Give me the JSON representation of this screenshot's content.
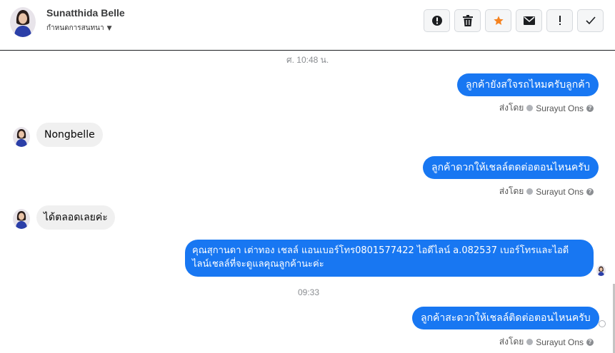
{
  "header": {
    "contact_name": "Sunatthida Belle",
    "assign_label": "กำหนดการสนทนา",
    "toolbar": [
      {
        "name": "spam-button",
        "icon": "alert-circle-icon"
      },
      {
        "name": "delete-button",
        "icon": "trash-icon"
      },
      {
        "name": "star-button",
        "icon": "star-icon"
      },
      {
        "name": "mark-unread-button",
        "icon": "envelope-icon"
      },
      {
        "name": "important-button",
        "icon": "exclamation-icon"
      },
      {
        "name": "done-button",
        "icon": "check-icon"
      }
    ]
  },
  "conversation": {
    "timestamp_1": "ศ. 10:48 น.",
    "timestamp_2": "09:33",
    "sender_prefix": "ส่งโดย",
    "sender_name": "Surayut Ons",
    "messages": [
      {
        "direction": "out",
        "text": "ลูกค้ายังสใจรถไหมครับลูกค้า"
      },
      {
        "direction": "in",
        "text": "Nongbelle"
      },
      {
        "direction": "out",
        "text": "ลูกค้าดวกให้เชลล์ตดต่อตอนไหนครับ"
      },
      {
        "direction": "in",
        "text": "ได้ตลอดเลยค่ะ"
      },
      {
        "direction": "out",
        "line1": "คุณสุกานดา เต่าทอง  เชลล์ แอนเบอร์โทร0801577422 ไอดีไลน์ a.082537  เบอร์โทรและไอดี",
        "line2": "ไลน์เชลล์ที่จะดูแลคุณลูกค้านะค่ะ"
      },
      {
        "direction": "out",
        "text": "ลูกค้าสะดวกให้เชลล์ติดต่อตอนไหนครับ"
      }
    ]
  },
  "colors": {
    "outgoing_bubble": "#1877f2",
    "incoming_bubble": "#f0f0f0",
    "star": "#f5821f"
  }
}
